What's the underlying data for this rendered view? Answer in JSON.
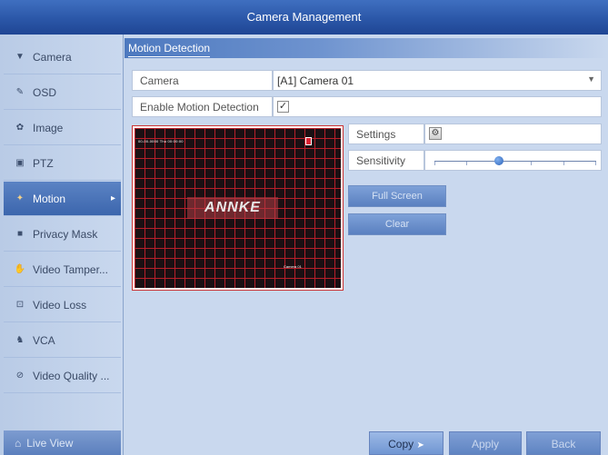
{
  "window": {
    "title": "Camera Management"
  },
  "sidebar": {
    "items": [
      {
        "label": "Camera",
        "icon": "camera-icon",
        "glyph": "▼"
      },
      {
        "label": "OSD",
        "icon": "osd-icon",
        "glyph": "✎"
      },
      {
        "label": "Image",
        "icon": "image-icon",
        "glyph": "✿"
      },
      {
        "label": "PTZ",
        "icon": "ptz-icon",
        "glyph": "▣"
      },
      {
        "label": "Motion",
        "icon": "motion-icon",
        "glyph": "✦"
      },
      {
        "label": "Privacy Mask",
        "icon": "privacy-mask-icon",
        "glyph": "■"
      },
      {
        "label": "Video Tamper...",
        "icon": "video-tamper-icon",
        "glyph": "✋"
      },
      {
        "label": "Video Loss",
        "icon": "video-loss-icon",
        "glyph": "⊡"
      },
      {
        "label": "VCA",
        "icon": "vca-icon",
        "glyph": "♞"
      },
      {
        "label": "Video Quality ...",
        "icon": "video-quality-icon",
        "glyph": "⊘"
      }
    ],
    "active": "Motion",
    "live_view": "Live View"
  },
  "main": {
    "section_title": "Motion Detection",
    "camera_label": "Camera",
    "camera_value": "[A1] Camera 01",
    "enable_label": "Enable Motion Detection",
    "enable_checked": "✓",
    "settings_label": "Settings",
    "sensitivity_label": "Sensitivity",
    "sensitivity_level": 0.4,
    "full_screen": "Full Screen",
    "clear": "Clear",
    "preview": {
      "logo": "ANNKE",
      "osd_time": "00-00-0000 Thu 00:00:00",
      "osd_camera": "Camera 01"
    }
  },
  "footer": {
    "copy": "Copy",
    "apply": "Apply",
    "back": "Back"
  },
  "colors": {
    "title_bar": "#2b57a8",
    "grid_line": "#c0202c",
    "active_item": "#3c66ad"
  }
}
